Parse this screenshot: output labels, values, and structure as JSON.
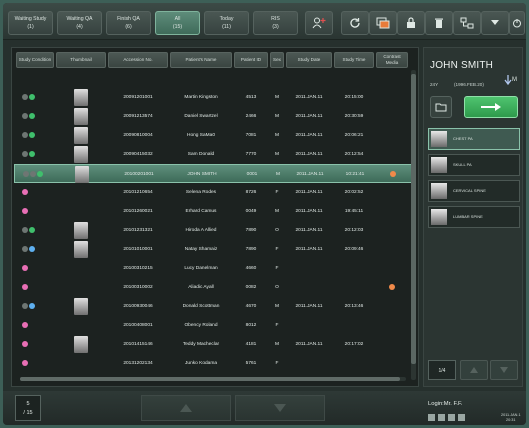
{
  "topbar": {
    "tabs": [
      {
        "label": "Waiting Study",
        "count": "(1)"
      },
      {
        "label": "Waiting QA",
        "count": "(4)"
      },
      {
        "label": "Finish QA",
        "count": "(6)"
      },
      {
        "label": "All",
        "count": "(15)"
      },
      {
        "label": "Today",
        "count": "(11)"
      },
      {
        "label": "RIS",
        "count": "(3)"
      }
    ],
    "active_tab": "All",
    "tools": [
      "add-user-icon",
      "refresh-icon",
      "image-transfer-icon",
      "lock-icon",
      "trash-icon",
      "network-icon",
      "dropdown-arrow-icon",
      "power-icon"
    ]
  },
  "table": {
    "columns": [
      "Study Condition",
      "Thumbnail",
      "Accession No.",
      "Patient's Name",
      "Patient ID",
      "Sex",
      "Study Date",
      "Study Time",
      "Contrast Media"
    ],
    "rows": [
      {
        "accession": "20091201001",
        "name": "Martin Kingston",
        "pid": "4513",
        "sex": "M",
        "date": "2011.JAN.11",
        "time": "20:15:00",
        "status": [
          "g",
          "green"
        ],
        "thumb": true,
        "selected": false,
        "contrast": false
      },
      {
        "accession": "20091213574",
        "name": "Daniel Swartzel",
        "pid": "2466",
        "sex": "M",
        "date": "2011.JAN.11",
        "time": "20:30:59",
        "status": [
          "g",
          "green"
        ],
        "thumb": true,
        "selected": false,
        "contrast": false
      },
      {
        "accession": "20090810004",
        "name": "Hong SaMa0",
        "pid": "7081",
        "sex": "M",
        "date": "2011.JAN.11",
        "time": "20:06:21",
        "status": [
          "g",
          "green"
        ],
        "thumb": true,
        "selected": false,
        "contrast": false
      },
      {
        "accession": "20090415032",
        "name": "Sam Donald",
        "pid": "7770",
        "sex": "M",
        "date": "2011.JAN.11",
        "time": "20:12:54",
        "status": [
          "g",
          "green"
        ],
        "thumb": true,
        "selected": false,
        "contrast": false
      },
      {
        "accession": "20100201001",
        "name": "JOHN SMITH",
        "pid": "0001",
        "sex": "M",
        "date": "2011.JAN.11",
        "time": "10:21:41",
        "status": [
          "g",
          "g",
          "green"
        ],
        "thumb": true,
        "selected": true,
        "contrast": true
      },
      {
        "accession": "20101210654",
        "name": "Selena Rodes",
        "pid": "8726",
        "sex": "F",
        "date": "2011.JAN.11",
        "time": "20:02:52",
        "status": [
          "pink"
        ],
        "thumb": false,
        "selected": false,
        "contrast": false
      },
      {
        "accession": "20101260021",
        "name": "Erhard Camus",
        "pid": "0049",
        "sex": "M",
        "date": "2011.JAN.11",
        "time": "19:45:11",
        "status": [
          "pink"
        ],
        "thumb": false,
        "selected": false,
        "contrast": false
      },
      {
        "accession": "20101231321",
        "name": "Hiroda A Allied",
        "pid": "7890",
        "sex": "O",
        "date": "2011.JAN.11",
        "time": "20:12:03",
        "status": [
          "g",
          "green"
        ],
        "thumb": true,
        "selected": false,
        "contrast": false
      },
      {
        "accession": "20101010001",
        "name": "Natay Shamaiz",
        "pid": "7890",
        "sex": "F",
        "date": "2011.JAN.11",
        "time": "20:09:46",
        "status": [
          "g",
          "blue"
        ],
        "thumb": true,
        "selected": false,
        "contrast": false
      },
      {
        "accession": "20100310215",
        "name": "Lucy Danelman",
        "pid": "4660",
        "sex": "F",
        "date": "",
        "time": "",
        "status": [
          "pink"
        ],
        "thumb": false,
        "selected": false,
        "contrast": false
      },
      {
        "accession": "20100310002",
        "name": "Aliadic Ayall",
        "pid": "0082",
        "sex": "O",
        "date": "",
        "time": "",
        "status": [
          "pink"
        ],
        "thumb": false,
        "selected": false,
        "contrast": true
      },
      {
        "accession": "20100930046",
        "name": "Donald Scottman",
        "pid": "4670",
        "sex": "M",
        "date": "2011.JAN.11",
        "time": "20:13:46",
        "status": [
          "g",
          "blue"
        ],
        "thumb": true,
        "selected": false,
        "contrast": false
      },
      {
        "accession": "20100408001",
        "name": "Obency Roland",
        "pid": "8012",
        "sex": "F",
        "date": "",
        "time": "",
        "status": [
          "pink"
        ],
        "thumb": false,
        "selected": false,
        "contrast": false
      },
      {
        "accession": "20101415146",
        "name": "Teddy Macheclar",
        "pid": "4181",
        "sex": "M",
        "date": "2011.JAN.11",
        "time": "20:17:02",
        "status": [
          "pink"
        ],
        "thumb": true,
        "selected": false,
        "contrast": false
      },
      {
        "accession": "20131202134",
        "name": "Junko Kodama",
        "pid": "5761",
        "sex": "F",
        "date": "",
        "time": "",
        "status": [
          "pink"
        ],
        "thumb": false,
        "selected": false,
        "contrast": false
      }
    ]
  },
  "patient": {
    "name": "JOHN SMITH",
    "age": "24Y",
    "dob": "(1996.FEB.20)",
    "sex_icon": "male-icon",
    "sex": "M"
  },
  "series": [
    {
      "label": "CHEST PA"
    },
    {
      "label": "SKULL PA"
    },
    {
      "label": "CERVICAL SPINE"
    },
    {
      "label": "LUMBAR SPINE"
    }
  ],
  "pager": {
    "series_page": "1/4"
  },
  "footer": {
    "count_current": "5",
    "count_total": "/ 15",
    "login": "Login:Mr. F.F.",
    "date": "2011.JAN.1",
    "time": "20:31"
  }
}
